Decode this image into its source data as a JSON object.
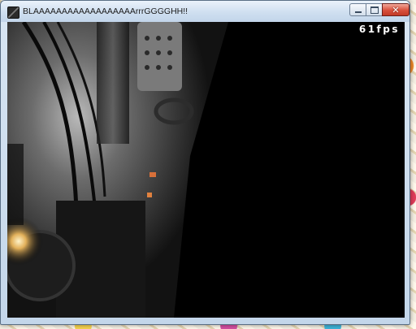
{
  "window": {
    "title": "BLAAAAAAAAAAAAAAAAAArrrGGGGHH!!",
    "icon": "app-icon",
    "controls": {
      "minimize": "minimize-icon",
      "maximize": "maximize-icon",
      "close": "close-icon"
    }
  },
  "viewport": {
    "fps": "61fps"
  }
}
